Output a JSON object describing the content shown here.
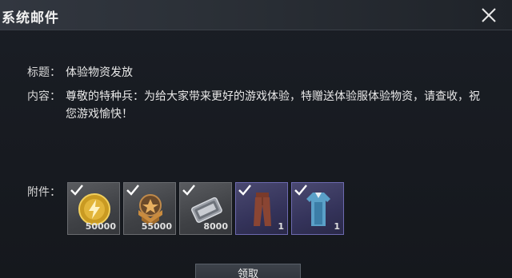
{
  "header": {
    "title": "系统邮件"
  },
  "mail": {
    "subject_label": "标题：",
    "subject": "体验物资发放",
    "content_label": "内容：",
    "content": "尊敬的特种兵：为给大家带来更好的游戏体验，特赠送体验服体验物资，请查收，祝您游戏愉快！",
    "attachments_label": "附件："
  },
  "attachments": [
    {
      "name": "gold-coin",
      "qty": "50000",
      "rarity": "common",
      "claimed": true
    },
    {
      "name": "rank-badge",
      "qty": "55000",
      "rarity": "common",
      "claimed": true
    },
    {
      "name": "exp-card",
      "qty": "8000",
      "rarity": "common",
      "claimed": true
    },
    {
      "name": "outfit-pants",
      "qty": "1",
      "rarity": "epic",
      "claimed": true
    },
    {
      "name": "outfit-suit",
      "qty": "1",
      "rarity": "epic",
      "claimed": true
    }
  ],
  "footer": {
    "claim_label": "领取"
  },
  "colors": {
    "epic_border": "#6d6ab0",
    "check": "#ffffff"
  }
}
